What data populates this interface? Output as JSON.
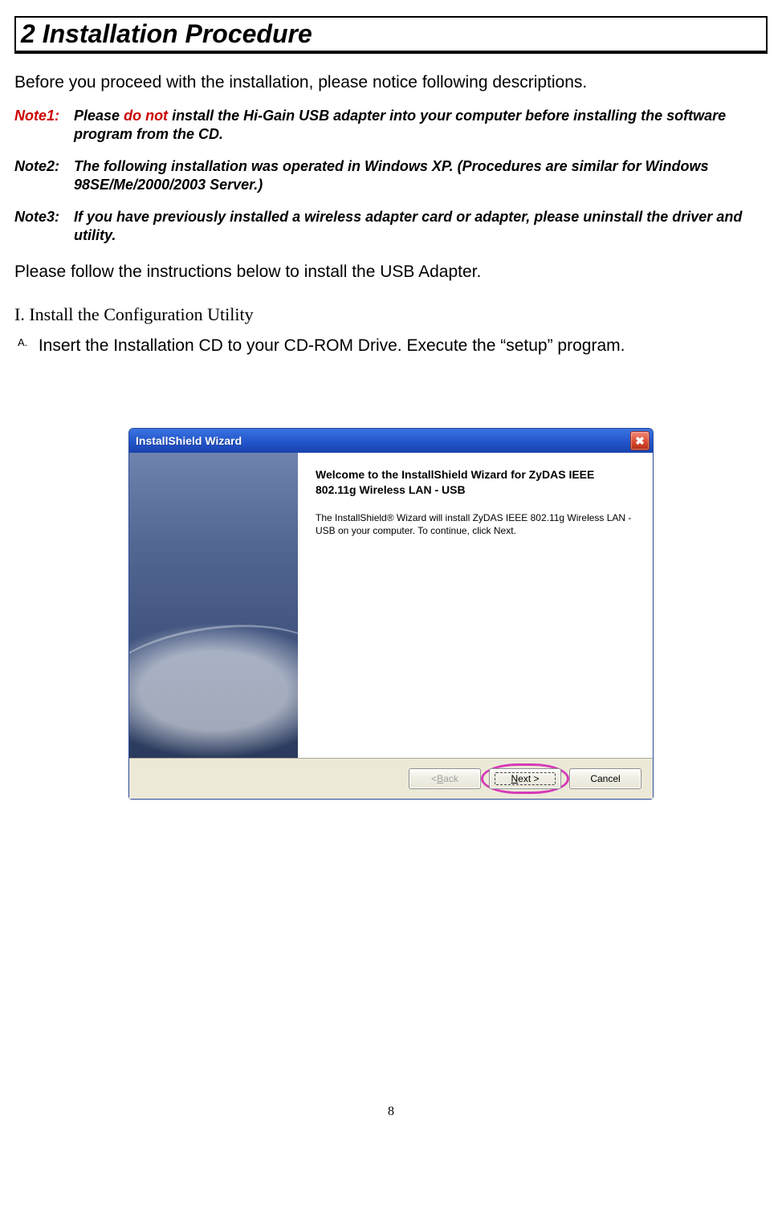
{
  "heading": "2  Installation Procedure",
  "intro": "Before you proceed with the installation, please notice following descriptions.",
  "notes": [
    {
      "label": "Note1:",
      "pre": "Please ",
      "em": "do not",
      "post": " install the Hi-Gain USB adapter into your computer before installing the software program from the CD."
    },
    {
      "label": "Note2:",
      "text": "The following installation was operated in Windows XP.   (Procedures are similar for Windows 98SE/Me/2000/2003 Server.)"
    },
    {
      "label": "Note3:",
      "text": "If you have previously installed a wireless adapter card or adapter, please uninstall the driver and utility."
    }
  ],
  "follow": "Please follow the instructions below to install the USB Adapter.",
  "subhead": "I. Install the Configuration Utility",
  "list": {
    "marker": "A.",
    "text": "Insert the Installation CD to your CD-ROM Drive. Execute the “setup” program."
  },
  "wizard": {
    "title": "InstallShield Wizard",
    "close_icon": "✖",
    "welcome": "Welcome to the InstallShield Wizard for ZyDAS IEEE 802.11g Wireless LAN - USB",
    "desc": "The InstallShield® Wizard will install ZyDAS IEEE 802.11g Wireless LAN - USB on your computer.  To continue, click Next.",
    "buttons": {
      "back_pre": "< ",
      "back_u": "B",
      "back_post": "ack",
      "next_u": "N",
      "next_post": "ext >",
      "cancel": "Cancel"
    }
  },
  "page_number": "8"
}
